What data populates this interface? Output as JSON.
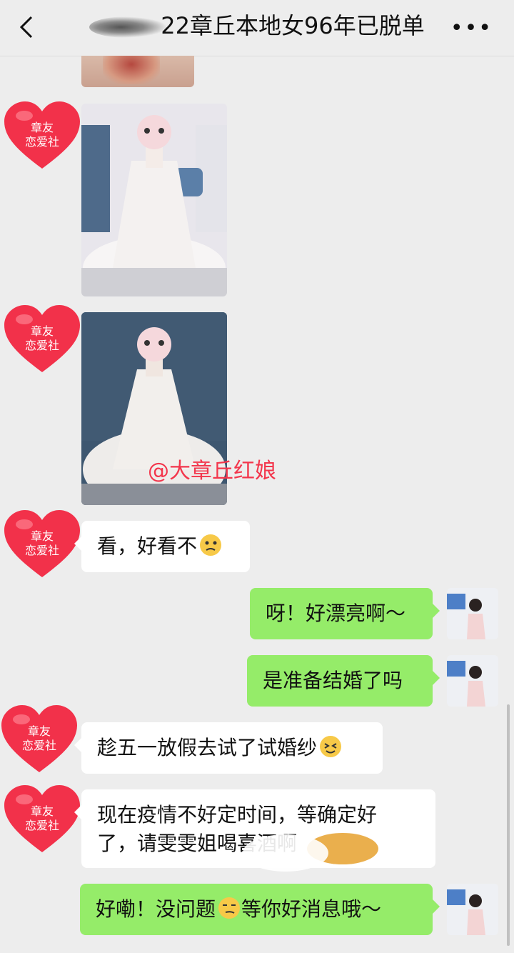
{
  "header": {
    "title": "22章丘本地女96年已脱单",
    "back_icon": "chevron-left-icon",
    "more_label": "•••"
  },
  "watermark": "@大章丘红娘",
  "sender_avatar": {
    "line1": "章友",
    "line2": "恋爱社"
  },
  "messages": [
    {
      "side": "left",
      "type": "text",
      "text": "看，好看不",
      "emoji": "thinking-face"
    },
    {
      "side": "right",
      "type": "text",
      "text": "呀！好漂亮啊～"
    },
    {
      "side": "right",
      "type": "text",
      "text": "是准备结婚了吗"
    },
    {
      "side": "left",
      "type": "text",
      "text": "趁五一放假去试了试婚纱",
      "emoji": "grinning-squint-face"
    },
    {
      "side": "left",
      "type": "text",
      "line1": "现在疫情不好定时间，等确定好",
      "line2": "了，请雯雯姐喝喜酒啊"
    },
    {
      "side": "right",
      "type": "text",
      "text": "好嘞！没问题",
      "text2": "等你好消息哦～",
      "emoji": "smirking-face"
    }
  ],
  "colors": {
    "background": "#ededed",
    "right_bubble": "#95ec69",
    "left_bubble": "#ffffff",
    "heart": "#f2314a",
    "watermark": "#f3364c"
  }
}
